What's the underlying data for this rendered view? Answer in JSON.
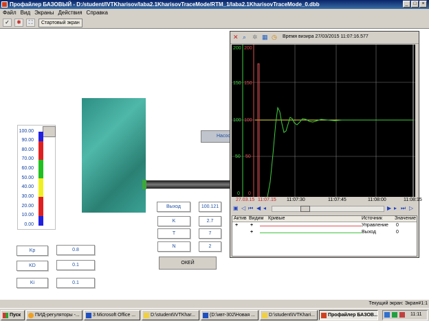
{
  "window": {
    "title": "Профайлер БАЗОВЫЙ - D:/student/IVTKharisov/laba2.1KharisovTraceMode/RTM_1/laba2.1KharisovTraceMode_0.dbb"
  },
  "menu": [
    "Файл",
    "Вид",
    "Экраны",
    "Действия",
    "Справка"
  ],
  "toolbar": {
    "start_screen": "Стартовый экран"
  },
  "gauge": {
    "labels": [
      "100.00",
      "90.00",
      "80.00",
      "70.00",
      "60.00",
      "50.00",
      "40.00",
      "30.00",
      "20.00",
      "10.00",
      "0.00"
    ]
  },
  "nasos_label": "Насос",
  "outputs": {
    "vykhod_label": "Выход",
    "vykhod_value": "100.121",
    "k_label": "K",
    "k_value": "2.7",
    "t_label": "T",
    "t_value": "7",
    "n_label": "N",
    "n_value": "2"
  },
  "ok_label": "ОКЕЙ",
  "params": {
    "kp_label": "Kp",
    "kp_value": "0.8",
    "kd_label": "KD",
    "kd_value": "0.1",
    "ki_label": "Ki",
    "ki_value": "0.1"
  },
  "trace": {
    "time_label": "Время визира 27/03/2015 11:07:16.577",
    "y_ticks": [
      "200",
      "150",
      "100",
      "50",
      "0"
    ],
    "start_date": "27.03.15",
    "start_time": "11:07.15",
    "x_ticks": [
      "11:07:30",
      "11:07:45",
      "11:08:00",
      "11:08:15"
    ],
    "table": {
      "headers": [
        "Актив",
        "Видим",
        "Кривые",
        "Источник",
        "Значение"
      ],
      "rows": [
        {
          "source": "Управление",
          "value": "0",
          "color": "#e05050"
        },
        {
          "source": "Выход",
          "value": "0",
          "color": "#40c040"
        }
      ]
    }
  },
  "status": {
    "current_screen": "Текущий экран: Экран#1:1"
  },
  "taskbar": {
    "start": "Пуск",
    "items": [
      "ПИД-регуляторы -...",
      "3 Microsoft Office ...",
      "D:\\student\\IVTKhar...",
      "(D:\\ивт-302\\Новая ...",
      "D:\\student\\IVTKhari...",
      "Профайлер БАЗОВ..."
    ],
    "clock": "11:11"
  },
  "colors": {
    "setpoint": "#e0e040",
    "control": "#e05050",
    "output": "#40d040"
  }
}
